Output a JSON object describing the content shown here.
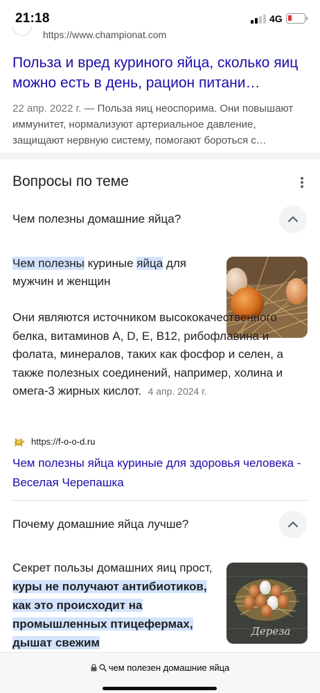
{
  "status_bar": {
    "time": "21:18",
    "network": "4G"
  },
  "previous_result": {
    "url": "https://www.championat.com",
    "title": "Польза и вред куриного яйца, сколько яиц можно есть в день, рацион питани…",
    "date": "22 апр. 2022 г.",
    "snippet": " — Польза яиц неоспорима. Они повышают иммунитет, нормализуют артериальное давление, защищают нервную систему, помогают бороться с…"
  },
  "paa": {
    "header": "Вопросы по теме",
    "questions": [
      {
        "question": "Чем полезны домашние яйца?",
        "heading_parts": [
          "Чем полезны",
          " куриные ",
          "яйца",
          " для мужчин и женщин"
        ],
        "answer": "Они являются источником высококачественного белка, витаминов A, D, E, B12, рибофлавина и фолата, минералов, таких как фосфор и селен, а также полезных соединений, например, холина и омега-3 жирных кислот.",
        "answer_date": "4 апр. 2024 г.",
        "source_url": "https://f-o-o-d.ru",
        "source_title": "Чем полезны яйца куриные для здоровья человека - Веселая Черепашка"
      },
      {
        "question": "Почему домашние яйца лучше?",
        "answer_plain": "Секрет пользы домашних яиц прост, ",
        "answer_highlight": "куры не получают антибиотиков, как это происходит на промышленных птицефермах, дышат свежим",
        "image_text": "Дереза"
      }
    ]
  },
  "browser": {
    "address": "чем полезен домашние яйца"
  },
  "colors": {
    "link": "#1a0dab",
    "highlight": "#d3e3fd",
    "chip": "#f1f3f4"
  }
}
